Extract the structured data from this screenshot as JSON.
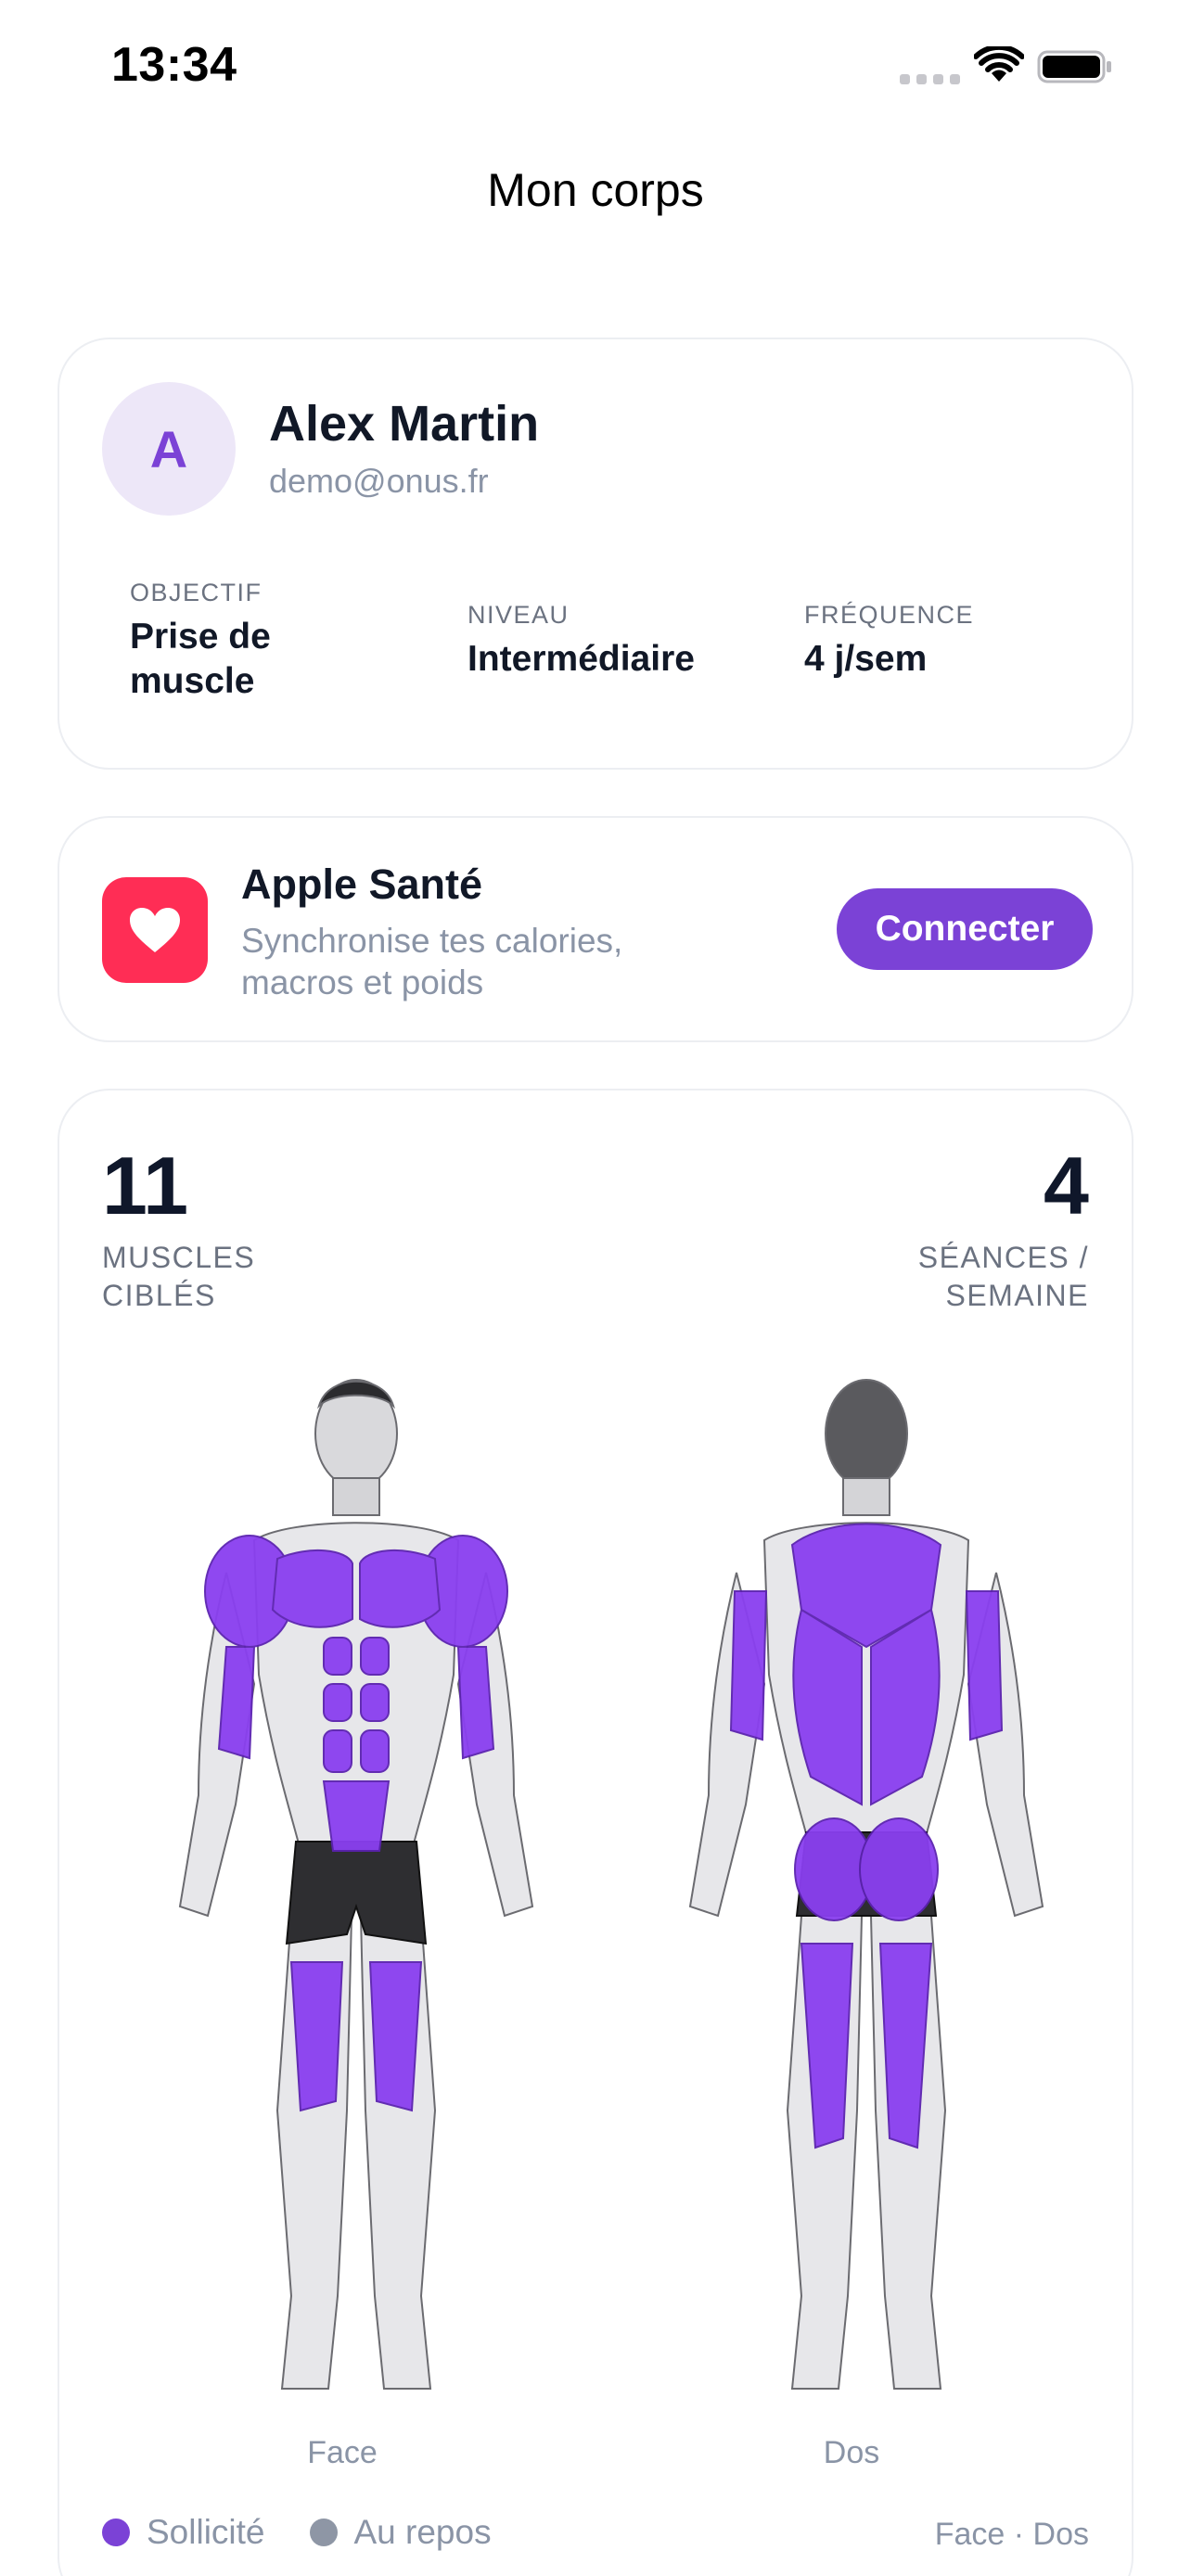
{
  "status_bar": {
    "time": "13:34"
  },
  "header": {
    "title": "Mon corps"
  },
  "profile": {
    "avatar_initial": "A",
    "name": "Alex Martin",
    "email": "demo@onus.fr",
    "stats": [
      {
        "label": "OBJECTIF",
        "value": "Prise de muscle"
      },
      {
        "label": "NIVEAU",
        "value": "Intermédiaire"
      },
      {
        "label": "FRÉQUENCE",
        "value": "4 j/sem"
      }
    ]
  },
  "health": {
    "title": "Apple Santé",
    "subtitle": "Synchronise tes calories, macros et poids",
    "button_label": "Connecter"
  },
  "muscles": {
    "targeted_count": "11",
    "targeted_label": "MUSCLES CIBLÉS",
    "sessions_count": "4",
    "sessions_label": "SÉANCES / SEMAINE",
    "front_caption": "Face",
    "back_caption": "Dos",
    "legend_active": "Sollicité",
    "legend_rest": "Au repos",
    "view_toggle": "Face · Dos"
  },
  "colors": {
    "accent": "#7b42d6",
    "active_muscle": "#8a3ff0",
    "heart_tile": "#ff2d55"
  }
}
